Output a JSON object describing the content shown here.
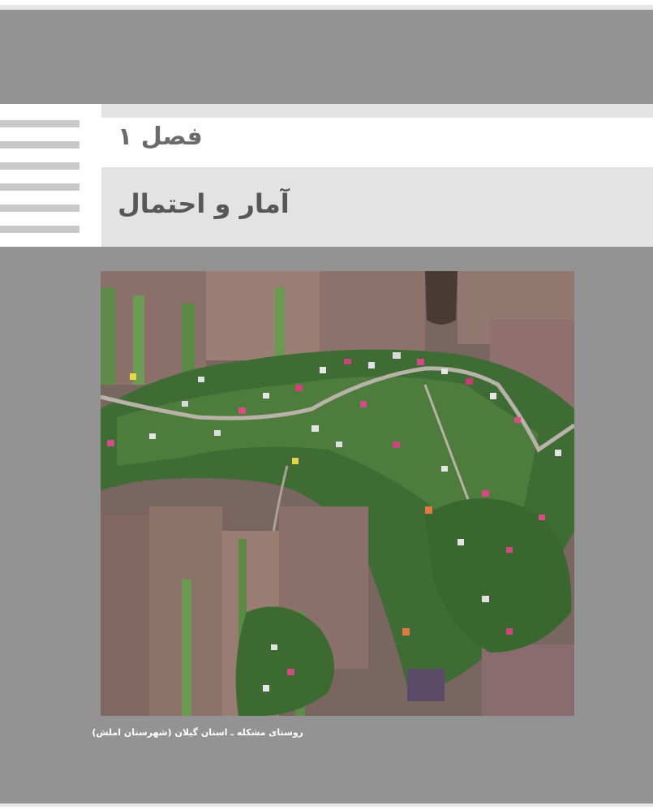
{
  "chapter": {
    "label": "فصل ۱",
    "title": "آمار و احتمال"
  },
  "figure": {
    "caption": "روستای مشکله ـ استان گیلان (شهرستان املش)",
    "description_icon": "aerial-village-photo"
  },
  "colors": {
    "page_background": "#949394",
    "header_white": "#ffffff",
    "header_light_gray": "#e3e3e3",
    "stripe_gray": "#c9c9c9",
    "title_text": "#575757"
  }
}
